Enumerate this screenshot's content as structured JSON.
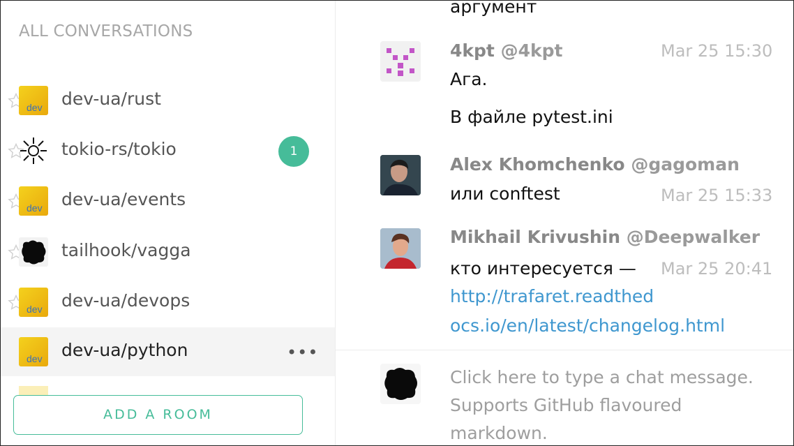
{
  "sidebar": {
    "heading": "ALL CONVERSATIONS",
    "rooms": [
      {
        "name": "dev-ua/rust",
        "avatar_text": "dev"
      },
      {
        "name": "tokio-rs/tokio",
        "badge": "1"
      },
      {
        "name": "dev-ua/events",
        "avatar_text": "dev"
      },
      {
        "name": "tailhook/vagga"
      },
      {
        "name": "dev-ua/devops",
        "avatar_text": "dev"
      },
      {
        "name": "dev-ua/python",
        "avatar_text": "dev",
        "more": "•••"
      }
    ],
    "add_room_label": "ADD A ROOM"
  },
  "chat": {
    "top_line": "аргумент",
    "messages": [
      {
        "author": "4kpt",
        "handle": "@4kpt",
        "time": "Mar 25 15:30",
        "lines": [
          "Ага.",
          "В файле pytest.ini"
        ]
      },
      {
        "author": "Alex Khomchenko",
        "handle": "@gagoman",
        "time": "Mar 25 15:33",
        "lines": [
          "или conftest"
        ]
      },
      {
        "author": "Mikhail Krivushin",
        "handle": "@Deepwalker",
        "time": "Mar 25 20:41",
        "lines": [
          "кто интересуется —"
        ],
        "link_lines": [
          "http://trafaret.readthed",
          "ocs.io/en/latest/changelog.html"
        ]
      }
    ],
    "composer": {
      "placeholder": "Click here to type a chat message. Supports GitHub flavoured markdown."
    }
  },
  "colors": {
    "accent": "#46bc99",
    "link": "#3f97cf",
    "active_row": "#f4f4f4"
  },
  "icons": [
    "star-icon",
    "dev-avatar",
    "sun-icon",
    "blob-avatar",
    "more-icon"
  ]
}
